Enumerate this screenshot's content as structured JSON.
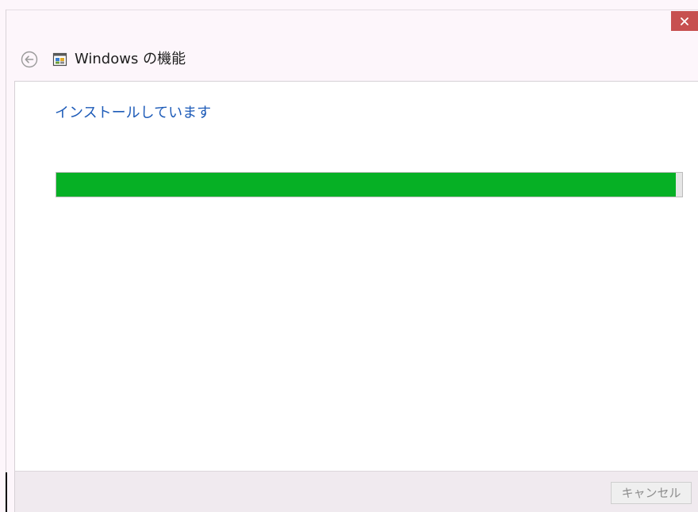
{
  "window": {
    "title": "Windows の機能",
    "accent_close_color": "#c75050"
  },
  "header": {
    "back_icon": "back-arrow-icon",
    "app_icon": "windows-features-icon"
  },
  "content": {
    "status": "インストールしています",
    "progress": {
      "percent": 99,
      "fill_color": "#06b025"
    }
  },
  "footer": {
    "cancel_label": "キャンセル"
  }
}
